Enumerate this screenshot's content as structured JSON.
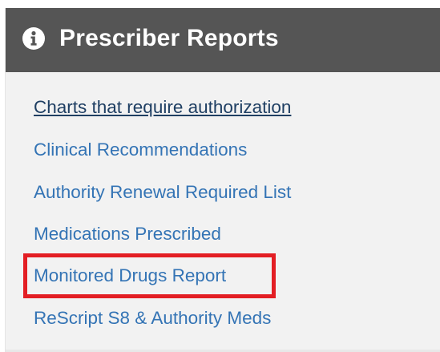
{
  "panel": {
    "title": "Prescriber Reports",
    "title_icon": "info-circle-icon",
    "header_bg": "#555555",
    "link_color": "#3474b5",
    "highlight_color": "#e31e24"
  },
  "reports": [
    {
      "label": "Charts that require authorization",
      "state": "hovered"
    },
    {
      "label": "Clinical Recommendations"
    },
    {
      "label": "Authority Renewal Required List"
    },
    {
      "label": "Medications Prescribed"
    },
    {
      "label": "Monitored Drugs Report",
      "highlighted": true
    },
    {
      "label": "ReScript S8 & Authority Meds"
    }
  ]
}
